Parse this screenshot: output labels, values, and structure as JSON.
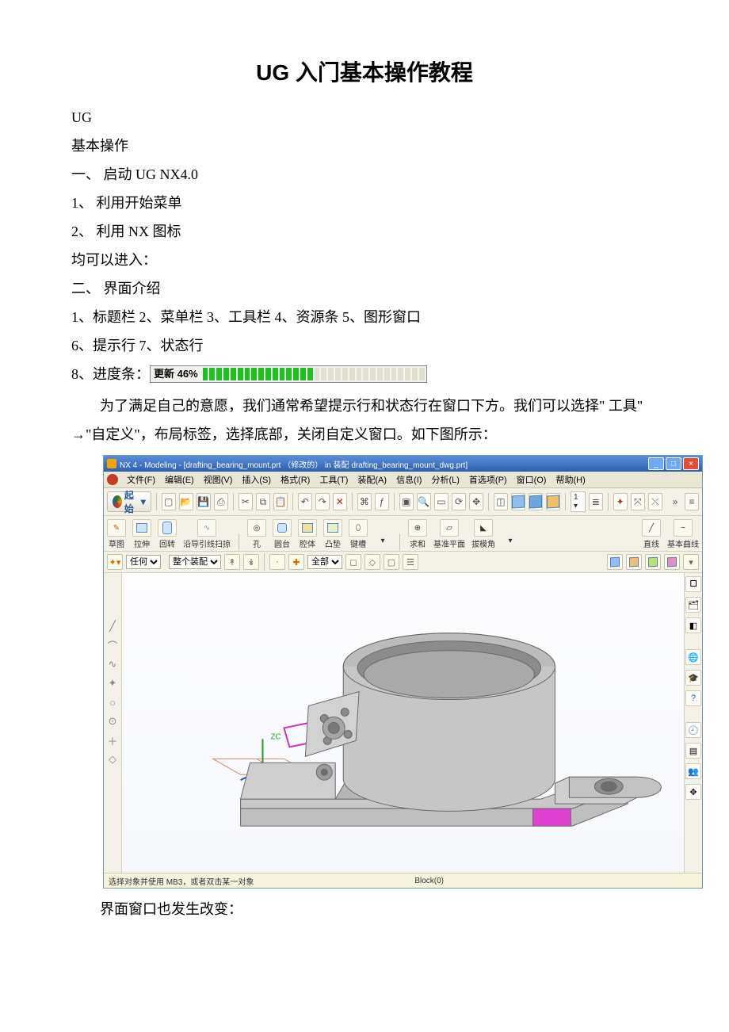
{
  "doc": {
    "title": "UG 入门基本操作教程",
    "line_ug": "UG",
    "line_ops": "基本操作",
    "line_h1": "一、 启动 UG NX4.0",
    "line1": "1、 利用开始菜单",
    "line2": "2、 利用 NX 图标",
    "line_can": "均可以进入：",
    "line_h2": "二、 界面介绍",
    "line_ui1": "1、标题栏  2、菜单栏  3、工具栏  4、资源条  5、图形窗口",
    "line_ui2": "6、提示行  7、状态行",
    "line8_label": "8、进度条：",
    "progress_label": "更新 46%",
    "para2": "为了满足自己的意愿，我们通常希望提示行和状态行在窗口下方。我们可以选择\" 工具\" →\"自定义\"，布局标签，选择底部，关闭自定义窗口。如下图所示：",
    "footer": "界面窗口也发生改变："
  },
  "app": {
    "titlebar": "NX 4 - Modeling - [drafting_bearing_mount.prt （修改的）  in 装配 drafting_bearing_mount_dwg.prt]",
    "menus": [
      "文件(F)",
      "编辑(E)",
      "视图(V)",
      "插入(S)",
      "格式(R)",
      "工具(T)",
      "装配(A)",
      "信息(I)",
      "分析(L)",
      "首选项(P)",
      "窗口(O)",
      "帮助(H)"
    ],
    "start": "起始",
    "tools2": [
      "草图",
      "拉伸",
      "回转",
      "沿导引线扫掠",
      "孔",
      "圆台",
      "腔体",
      "凸垫",
      "键槽",
      "",
      "求和",
      "基准平面",
      "拔模角",
      "",
      "直线",
      "基本曲线"
    ],
    "filter1": "任何",
    "filter2": "整个装配",
    "filter3": "全部",
    "axis_label": "ZC",
    "status_left": "选择对象并使用 MB3，或者双击某一对象",
    "status_right": "Block(0)"
  }
}
